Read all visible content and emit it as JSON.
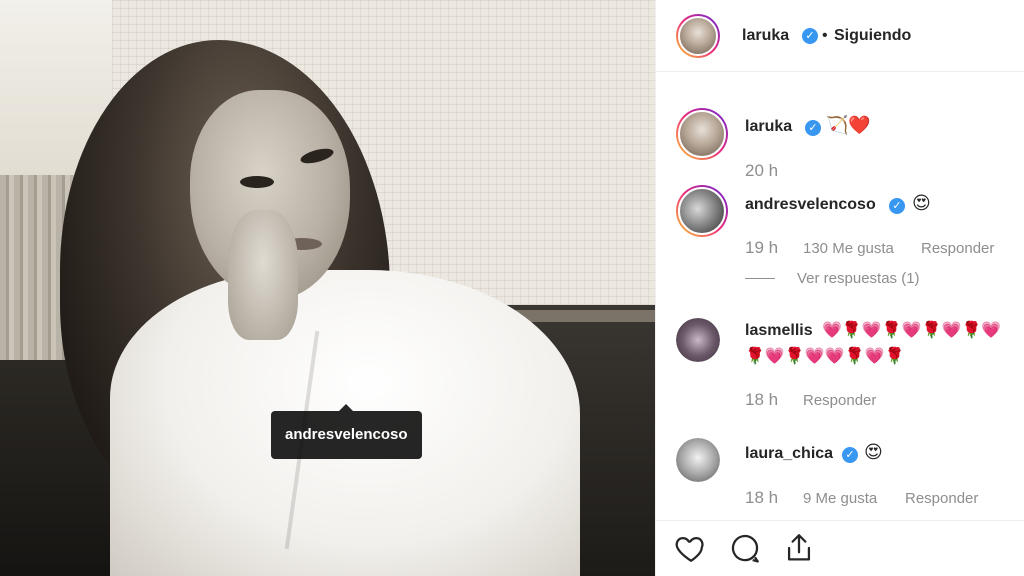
{
  "post": {
    "tag_label": "andresvelencoso"
  },
  "header": {
    "username": "laruka",
    "verified_mark": "✓",
    "separator": "•",
    "follow_status": "Siguiendo"
  },
  "caption": {
    "username": "laruka",
    "verified_mark": "✓",
    "text": "🏹❤️",
    "time": "20 h"
  },
  "comments": [
    {
      "username": "andresvelencoso",
      "verified_mark": "✓",
      "text": "😍",
      "time": "19 h",
      "likes": "130 Me gusta",
      "reply_label": "Responder",
      "view_replies": "Ver respuestas (1)"
    },
    {
      "username": "lasmellis",
      "text_line1": "💗🌹💗🌹💗🌹💗🌹💗",
      "text_line2": "🌹💗🌹💗💗🌹💗🌹",
      "time": "18 h",
      "reply_label": "Responder"
    },
    {
      "username": "laura_chica",
      "verified_mark": "✓",
      "text": "😍",
      "time": "18 h",
      "likes": "9 Me gusta",
      "reply_label": "Responder"
    }
  ],
  "actions": {
    "like_icon": "heart-icon",
    "comment_icon": "comment-icon",
    "share_icon": "share-icon"
  },
  "colors": {
    "verified": "#3897f0",
    "text": "#262626",
    "muted": "#8e8e8e",
    "tooltip_bg": "#000000"
  }
}
